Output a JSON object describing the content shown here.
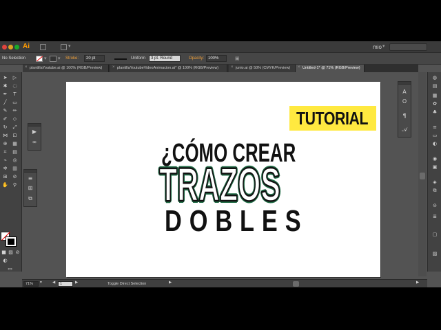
{
  "app": {
    "logo": "Ai",
    "workspace": "mio"
  },
  "control_bar": {
    "selection": "No Selection",
    "stroke_label": "Stroke:",
    "stroke_weight": "20 pt",
    "stroke_profile": "Uniform",
    "brush": "3 pt. Round",
    "opacity_label": "Opacity:",
    "opacity_value": "100%"
  },
  "tabs": [
    {
      "label": "plantillaYoutube.ai @ 100% (RGB/Preview)",
      "active": false
    },
    {
      "label": "plantillaYoutubeVideoAnimacion.ai* @ 100% (RGB/Preview)",
      "active": false
    },
    {
      "label": "junio.ai @ 50% (CMYK/Preview)",
      "active": false
    },
    {
      "label": "Untitled-1* @ 71% (RGB/Preview)",
      "active": true
    }
  ],
  "artwork": {
    "badge": "TUTORIAL",
    "line1": "¿CÓMO CREAR",
    "line2": "TRAZOS",
    "line3": "DOBLES"
  },
  "status_bar": {
    "zoom": "71%",
    "artboard_number": "1",
    "tool_hint": "Toggle Direct Selection"
  },
  "colors": {
    "badge_yellow": "#ffe940",
    "outline_green": "#1f6b45",
    "accent_orange": "#f0a03a"
  }
}
